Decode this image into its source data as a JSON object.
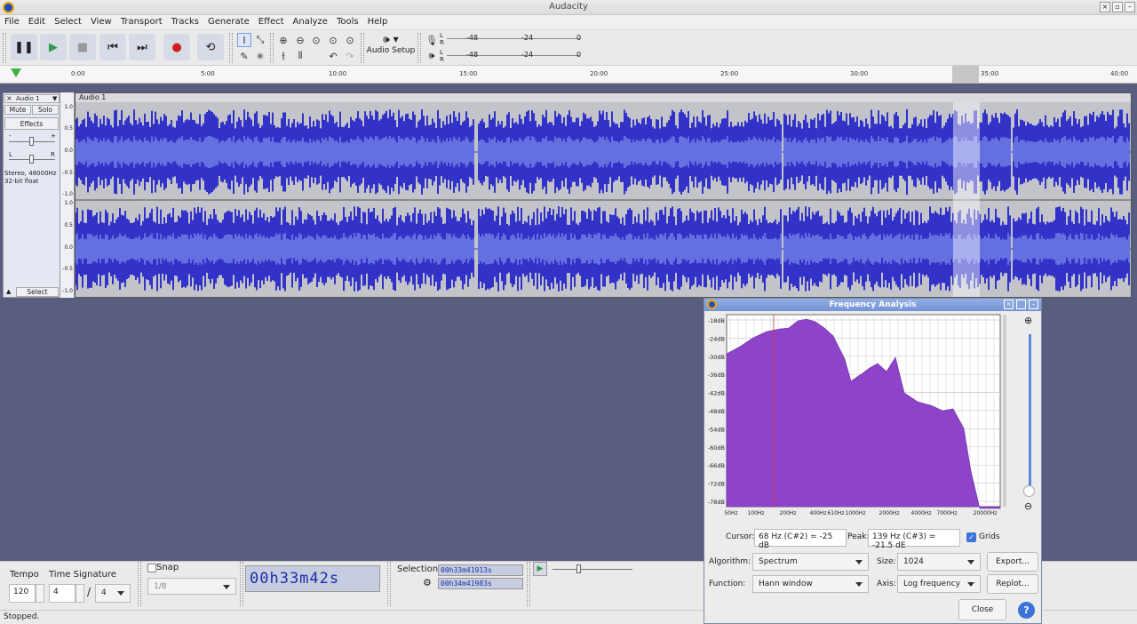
{
  "window": {
    "title": "Audacity"
  },
  "menu": [
    "File",
    "Edit",
    "Select",
    "View",
    "Transport",
    "Tracks",
    "Generate",
    "Effect",
    "Analyze",
    "Tools",
    "Help"
  ],
  "toolbar": {
    "audio_setup_label": "Audio Setup",
    "meter_rec_ticks": [
      "-48",
      "-24",
      "0"
    ],
    "meter_play_ticks": [
      "-48",
      "-24",
      "0"
    ],
    "meter_channel_l": "L",
    "meter_channel_r": "R"
  },
  "timeline": {
    "ticks": [
      "0:00",
      "5:00",
      "10:00",
      "15:00",
      "20:00",
      "25:00",
      "30:00",
      "35:00",
      "40:00"
    ]
  },
  "track": {
    "name": "Audio 1",
    "clip_name": "Audio 1",
    "mute_label": "Mute",
    "solo_label": "Solo",
    "effects_label": "Effects",
    "pan_l": "L",
    "pan_r": "R",
    "gain_minus": "-",
    "gain_plus": "+",
    "format_line1": "Stereo, 48000Hz",
    "format_line2": "32-bit float",
    "select_label": "Select",
    "scale_labels": [
      "1.0",
      "0.5",
      "0.0",
      "-0.5",
      "-1.0"
    ],
    "waveform_color": "#3232c8"
  },
  "bottom": {
    "tempo_label": "Tempo",
    "tempo_value": "120",
    "timesig_label": "Time Signature",
    "timesig_num": "4",
    "timesig_sep": "/",
    "timesig_den": "4",
    "snap_label": "Snap",
    "snap_value": "1/8",
    "time_display": "00h33m42s",
    "selection_label": "Selection",
    "sel_start": "00h33m41913s",
    "sel_end": "00h34m41983s"
  },
  "status": {
    "text": "Stopped."
  },
  "frequency_dialog": {
    "title": "Frequency Analysis",
    "db_labels": [
      "-18dB",
      "-24dB",
      "-30dB",
      "-36dB",
      "-42dB",
      "-48dB",
      "-54dB",
      "-60dB",
      "-66dB",
      "-72dB",
      "-78dB"
    ],
    "freq_labels": [
      "50Hz",
      "100Hz",
      "200Hz",
      "400Hz",
      "610Hz",
      "1000Hz",
      "2000Hz",
      "4000Hz",
      "7000Hz",
      "20000Hz"
    ],
    "cursor_label": "Cursor:",
    "cursor_value": "68 Hz (C#2) = -25 dB",
    "peak_label": "Peak:",
    "peak_value": "139 Hz (C#3) = -21.5 dE",
    "grids_label": "Grids",
    "grids_checked": true,
    "algorithm_label": "Algorithm:",
    "algorithm_value": "Spectrum",
    "size_label": "Size:",
    "size_value": "1024",
    "export_label": "Export...",
    "function_label": "Function:",
    "function_value": "Hann window",
    "axis_label": "Axis:",
    "axis_value": "Log frequency",
    "replot_label": "Replot...",
    "close_label": "Close",
    "help_label": "?",
    "spectrum_color": "#8e44c8"
  }
}
